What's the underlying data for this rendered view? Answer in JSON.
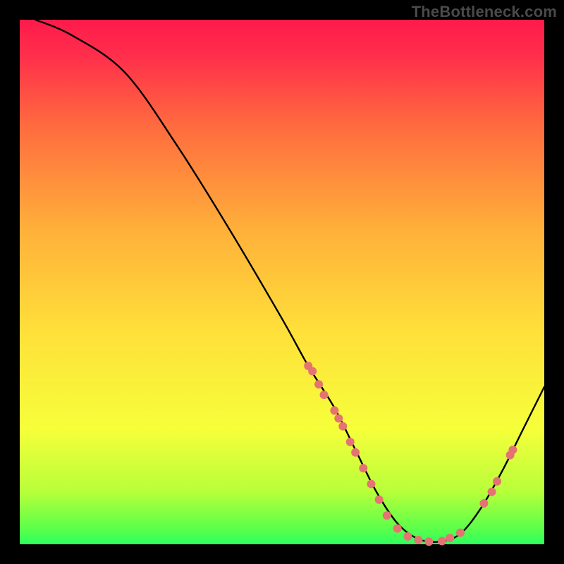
{
  "watermark": "TheBottleneck.com",
  "colors": {
    "background": "#000000",
    "curve": "#000000",
    "markers": "#e57373",
    "gradient_top": "#ff1a4b",
    "gradient_mid": "#ffd83b",
    "gradient_bottom": "#2cff5e",
    "watermark_text": "#4a4a4a"
  },
  "chart_data": {
    "type": "line",
    "title": "",
    "xlabel": "",
    "ylabel": "",
    "xlim": [
      0,
      100
    ],
    "ylim": [
      0,
      100
    ],
    "curve": {
      "x": [
        3,
        10,
        20,
        30,
        40,
        50,
        55,
        60,
        64,
        68,
        72,
        76,
        80,
        84,
        88,
        92,
        96,
        100
      ],
      "y": [
        100,
        97,
        90,
        76,
        60,
        43,
        34,
        26,
        18,
        10,
        4,
        1,
        0.5,
        2,
        7,
        14,
        22,
        30
      ]
    },
    "markers": [
      {
        "x": 55.0,
        "y": 34.0
      },
      {
        "x": 55.8,
        "y": 33.0
      },
      {
        "x": 57.0,
        "y": 30.5
      },
      {
        "x": 58.0,
        "y": 28.5
      },
      {
        "x": 60.0,
        "y": 25.5
      },
      {
        "x": 60.8,
        "y": 24.0
      },
      {
        "x": 61.6,
        "y": 22.5
      },
      {
        "x": 63.0,
        "y": 19.5
      },
      {
        "x": 64.0,
        "y": 17.5
      },
      {
        "x": 65.5,
        "y": 14.5
      },
      {
        "x": 67.0,
        "y": 11.5
      },
      {
        "x": 68.5,
        "y": 8.5
      },
      {
        "x": 70.0,
        "y": 5.5
      },
      {
        "x": 72.0,
        "y": 3.0
      },
      {
        "x": 74.0,
        "y": 1.5
      },
      {
        "x": 76.0,
        "y": 0.8
      },
      {
        "x": 78.0,
        "y": 0.5
      },
      {
        "x": 80.5,
        "y": 0.6
      },
      {
        "x": 82.0,
        "y": 1.2
      },
      {
        "x": 84.0,
        "y": 2.2
      },
      {
        "x": 88.5,
        "y": 7.8
      },
      {
        "x": 90.0,
        "y": 10.0
      },
      {
        "x": 91.0,
        "y": 12.0
      },
      {
        "x": 93.5,
        "y": 17.0
      },
      {
        "x": 94.0,
        "y": 18.0
      }
    ]
  }
}
